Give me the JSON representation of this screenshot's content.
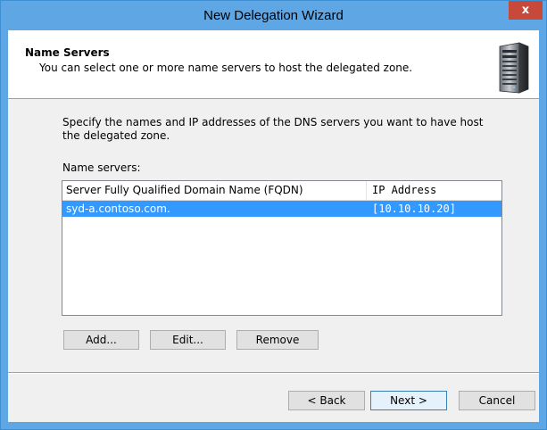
{
  "window": {
    "title": "New Delegation Wizard",
    "close_label": "x"
  },
  "header": {
    "title": "Name Servers",
    "subtitle": "You can select one or more name servers to host the delegated zone.",
    "icon": "server-tower-icon"
  },
  "body": {
    "instructions": "Specify the names and IP addresses of the DNS servers you want to have host the delegated zone.",
    "list_label": "Name servers:"
  },
  "list": {
    "columns": [
      "Server Fully Qualified Domain Name (FQDN)",
      "IP Address"
    ],
    "rows": [
      {
        "fqdn": "syd-a.contoso.com.",
        "ip": "[10.10.10.20]",
        "selected": true
      }
    ]
  },
  "list_buttons": {
    "add": "Add...",
    "edit": "Edit...",
    "remove": "Remove"
  },
  "footer": {
    "back": "< Back",
    "next": "Next >",
    "cancel": "Cancel"
  },
  "colors": {
    "titlebar": "#5fa6e4",
    "close": "#c7493a",
    "selection": "#3399ff"
  }
}
